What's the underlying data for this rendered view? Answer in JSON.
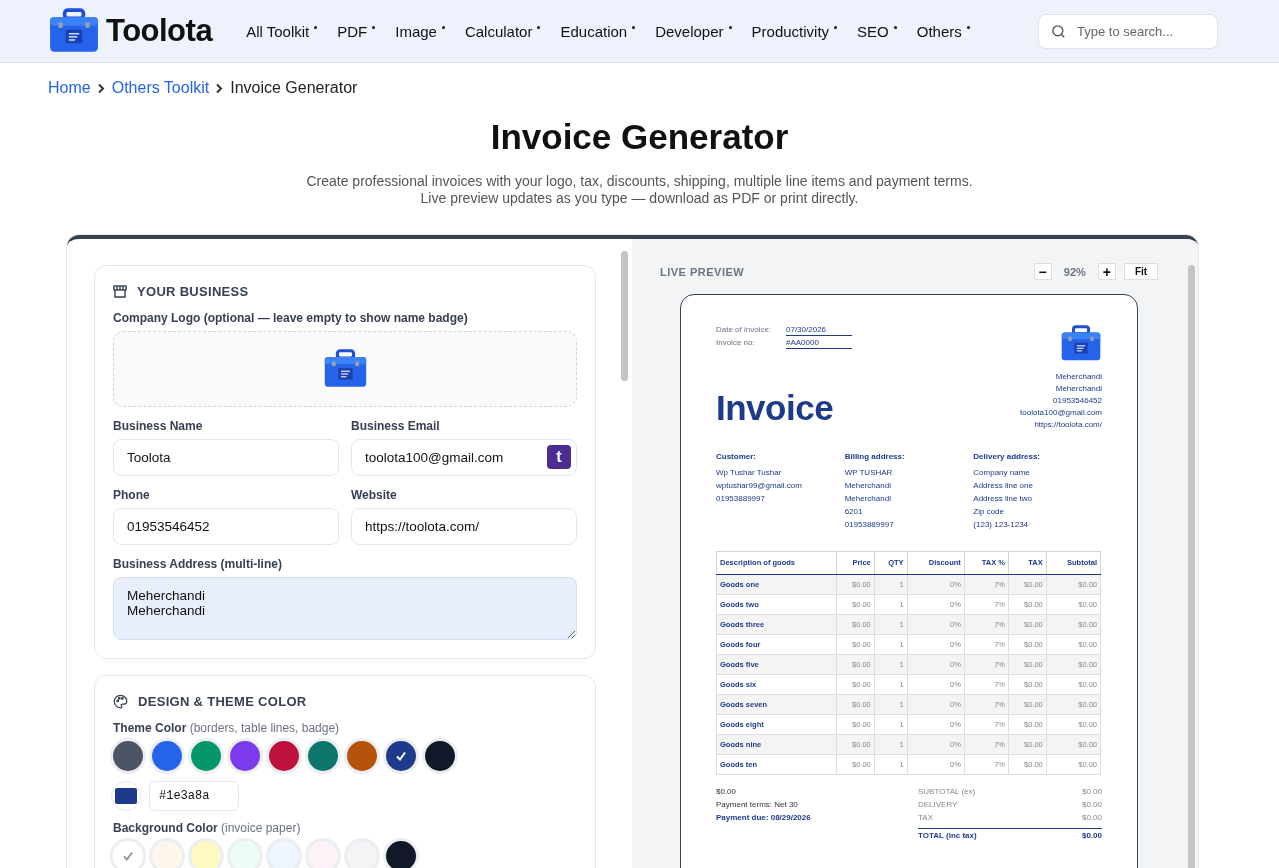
{
  "header": {
    "logo_text": "Toolota",
    "nav": [
      {
        "label": "All Toolkit"
      },
      {
        "label": "PDF"
      },
      {
        "label": "Image"
      },
      {
        "label": "Calculator"
      },
      {
        "label": "Education"
      },
      {
        "label": "Developer"
      },
      {
        "label": "Productivity"
      },
      {
        "label": "SEO"
      },
      {
        "label": "Others"
      }
    ],
    "search": {
      "placeholder": "Type to search..."
    }
  },
  "breadcrumb": [
    {
      "label": "Home",
      "kind": "link"
    },
    {
      "label": "Others Toolkit",
      "kind": "link"
    },
    {
      "label": "Invoice Generator",
      "kind": "current"
    }
  ],
  "title": "Invoice Generator",
  "subtitle": "Create professional invoices with your logo, tax, discounts, shipping, multiple line items and payment terms. Live preview updates as you type — download as PDF or print directly.",
  "business": {
    "title": "YOUR BUSINESS",
    "logo_label": "Company Logo (optional — leave empty to show name badge)",
    "fields": [
      {
        "label": "Business Name",
        "value": "Toolota"
      },
      {
        "label": "Business Email",
        "value": "toolota100@gmail.com",
        "badge": "t"
      },
      {
        "label": "Phone",
        "value": "01953546452"
      },
      {
        "label": "Website",
        "value": "https://toolota.com/"
      }
    ],
    "address": {
      "label": "Business Address (multi-line)",
      "value": "Meherchandi\nMeherchandi"
    }
  },
  "design": {
    "title": "DESIGN & THEME COLOR",
    "theme_color": {
      "label": "Theme Color",
      "hint": "(borders, table lines, badge)",
      "swatches": [
        {
          "color": "#4b5563",
          "selected": false
        },
        {
          "color": "#2563eb",
          "selected": false
        },
        {
          "color": "#059669",
          "selected": false
        },
        {
          "color": "#7c3aed",
          "selected": false
        },
        {
          "color": "#be123c",
          "selected": false
        },
        {
          "color": "#0f766e",
          "selected": false
        },
        {
          "color": "#b45309",
          "selected": false
        },
        {
          "color": "#1e3a8a",
          "selected": true
        },
        {
          "color": "#111827",
          "selected": false
        }
      ],
      "custom_value": "#1e3a8a"
    },
    "background_color": {
      "label": "Background Color",
      "hint": "(invoice paper)",
      "swatches": [
        {
          "color": "#ffffff",
          "selected": true
        },
        {
          "color": "#fdf6ec",
          "selected": false
        },
        {
          "color": "#fef9c3",
          "selected": false
        },
        {
          "color": "#ecfdf5",
          "selected": false
        },
        {
          "color": "#eff6ff",
          "selected": false
        },
        {
          "color": "#fdf2f8",
          "selected": false
        },
        {
          "color": "#f3f4f6",
          "selected": false
        },
        {
          "color": "#111827",
          "selected": false
        }
      ]
    }
  },
  "preview": {
    "title": "LIVE PREVIEW",
    "zoom_out": "−",
    "zoom": "92%",
    "zoom_in": "+",
    "fit": "Fit",
    "invoice": {
      "date_label": "Date of invoice:",
      "date": "07/30/2026",
      "number_label": "Invoice no:",
      "number": "#AA0000",
      "heading": "Invoice",
      "sender_lines": [
        "Meherchandi",
        "Meherchandi",
        "01953546452",
        "toolota100@gmail.com",
        "https://toolota.com/"
      ],
      "parties": [
        {
          "title": "Customer:",
          "lines": [
            "Wp Tushar Tushar",
            "wptushar99@gmail.com",
            "01953889997"
          ]
        },
        {
          "title": "Billing address:",
          "lines": [
            "WP TUSHAR",
            "Meherchandi",
            "Meherchandi",
            "6201",
            "01953889997"
          ]
        },
        {
          "title": "Delivery address:",
          "lines": [
            "Company name",
            "Address line one",
            "Address line two",
            "Zip code",
            "(123) 123-1234"
          ]
        }
      ],
      "columns": [
        "Description of goods",
        "Price",
        "QTY",
        "Discount",
        "TAX %",
        "TAX",
        "Subtotal"
      ],
      "rows": [
        [
          "Goods one",
          "$0.00",
          "1",
          "0%",
          "7%",
          "$0.00",
          "$0.00"
        ],
        [
          "Goods two",
          "$0.00",
          "1",
          "0%",
          "7%",
          "$0.00",
          "$0.00"
        ],
        [
          "Goods three",
          "$0.00",
          "1",
          "0%",
          "7%",
          "$0.00",
          "$0.00"
        ],
        [
          "Goods four",
          "$0.00",
          "1",
          "0%",
          "7%",
          "$0.00",
          "$0.00"
        ],
        [
          "Goods five",
          "$0.00",
          "1",
          "0%",
          "7%",
          "$0.00",
          "$0.00"
        ],
        [
          "Goods six",
          "$0.00",
          "1",
          "0%",
          "7%",
          "$0.00",
          "$0.00"
        ],
        [
          "Goods seven",
          "$0.00",
          "1",
          "0%",
          "7%",
          "$0.00",
          "$0.00"
        ],
        [
          "Goods eight",
          "$0.00",
          "1",
          "0%",
          "7%",
          "$0.00",
          "$0.00"
        ],
        [
          "Goods nine",
          "$0.00",
          "1",
          "0%",
          "7%",
          "$0.00",
          "$0.00"
        ],
        [
          "Goods ten",
          "$0.00",
          "1",
          "0%",
          "7%",
          "$0.00",
          "$0.00"
        ]
      ],
      "amount": "$0.00",
      "terms": "Payment terms: Net 30",
      "due": "Payment due: 08/29/2026",
      "totals": [
        {
          "label": "SUBTOTAL (ex)",
          "value": "$0.00"
        },
        {
          "label": "DELIVERY",
          "value": "$0.00"
        },
        {
          "label": "TAX",
          "value": "$0.00"
        }
      ],
      "grand_total": {
        "label": "TOTAL (inc tax)",
        "value": "$0.00"
      }
    }
  }
}
